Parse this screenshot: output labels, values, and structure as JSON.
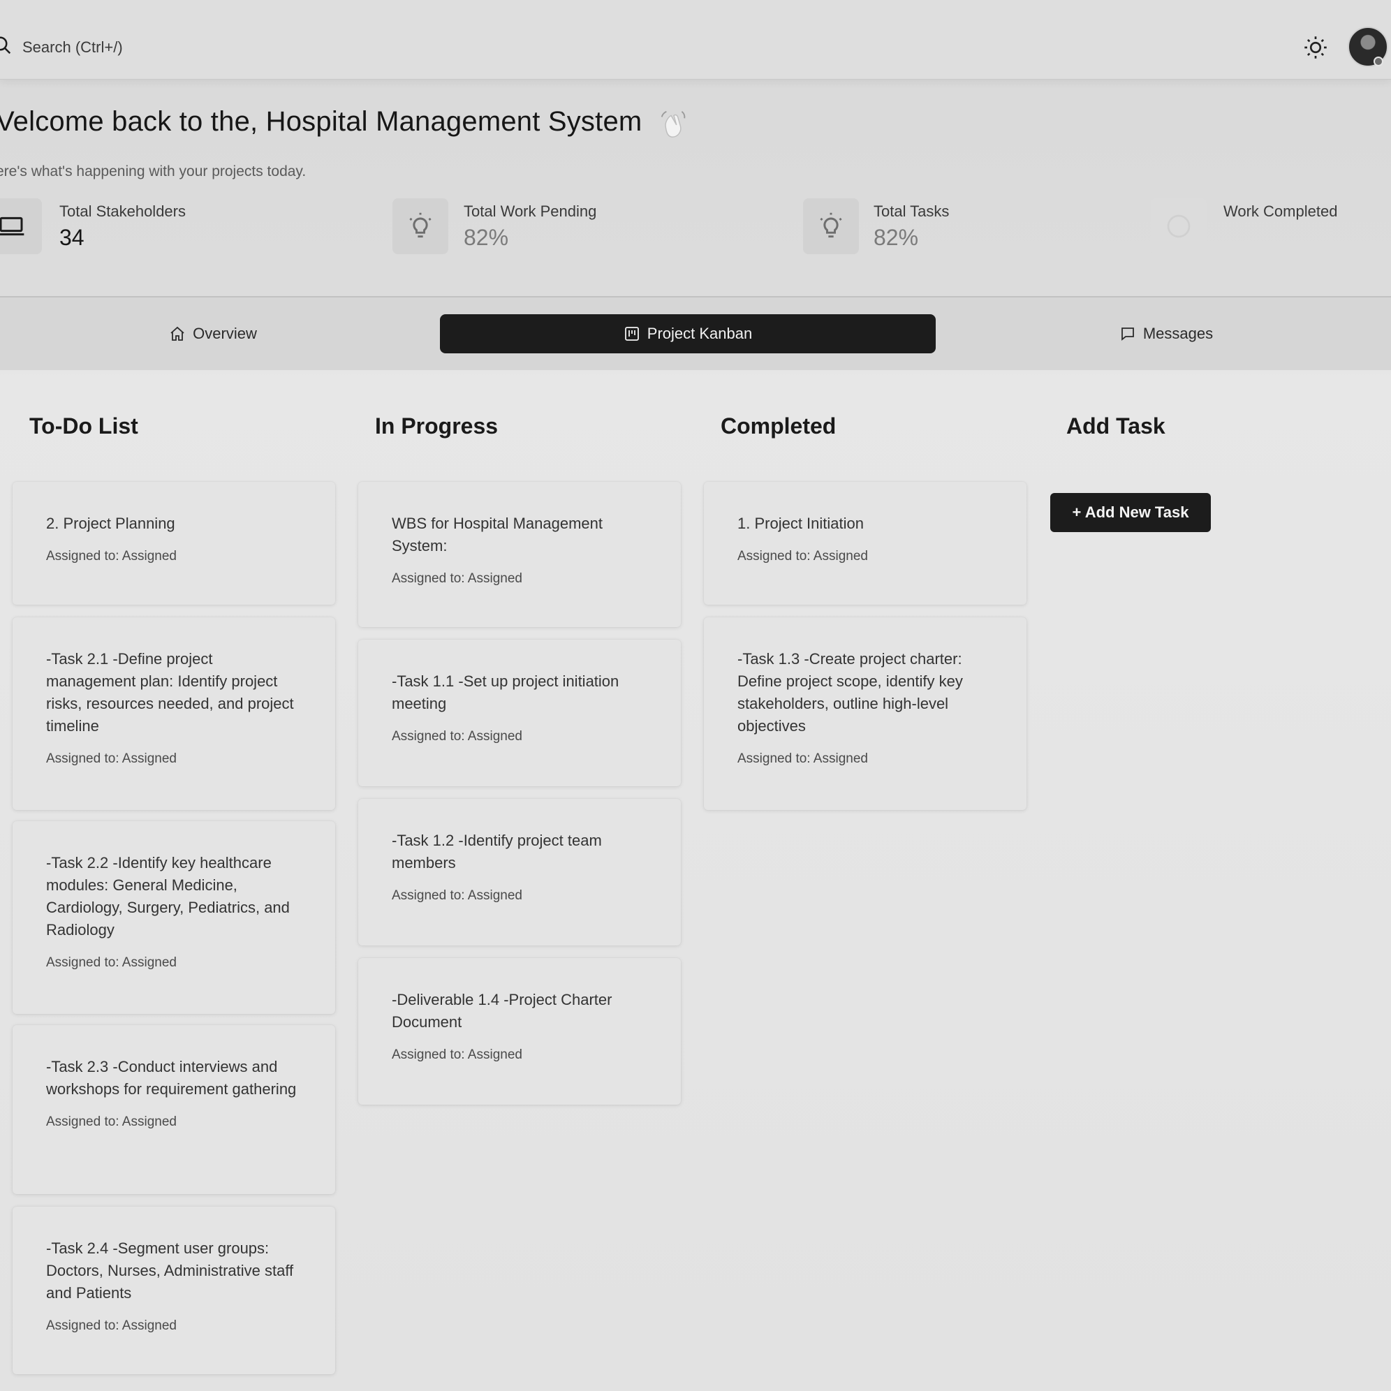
{
  "search": {
    "placeholder": "Search (Ctrl+/)"
  },
  "header": {
    "welcome": "Velcome back to the, Hospital Management System",
    "subtitle": "ere's what's happening with your projects today."
  },
  "stats": [
    {
      "label": "Total Stakeholders",
      "value": "34",
      "icon": "laptop-icon"
    },
    {
      "label": "Total Work Pending",
      "value": "82%",
      "icon": "lightbulb-icon"
    },
    {
      "label": "Total Tasks",
      "value": "82%",
      "icon": "lightbulb-icon"
    },
    {
      "label": "Work Completed",
      "value": "",
      "icon": "check-circle-icon"
    }
  ],
  "tabs": [
    {
      "label": "Overview",
      "icon": "home-icon"
    },
    {
      "label": "Project Kanban",
      "icon": "kanban-icon",
      "active": true
    },
    {
      "label": "Messages",
      "icon": "message-icon"
    }
  ],
  "kanban": {
    "columns": [
      {
        "title": "To-Do List",
        "cards": [
          {
            "title": "2. Project Planning",
            "assigned": "Assigned to: Assigned"
          },
          {
            "title": "-Task 2.1 -Define project management plan: Identify project risks, resources needed, and project timeline",
            "assigned": "Assigned to: Assigned"
          },
          {
            "title": "-Task 2.2 -Identify key healthcare modules: General Medicine, Cardiology, Surgery, Pediatrics, and Radiology",
            "assigned": "Assigned to: Assigned"
          },
          {
            "title": "-Task 2.3 -Conduct interviews and workshops for requirement gathering",
            "assigned": "Assigned to: Assigned"
          },
          {
            "title": "-Task 2.4 -Segment user groups: Doctors, Nurses, Administrative staff and Patients",
            "assigned": "Assigned to: Assigned"
          }
        ]
      },
      {
        "title": "In Progress",
        "cards": [
          {
            "title": "WBS for Hospital Management System:",
            "assigned": "Assigned to: Assigned"
          },
          {
            "title": "-Task 1.1 -Set up project initiation meeting",
            "assigned": "Assigned to: Assigned"
          },
          {
            "title": "-Task 1.2 -Identify project team members",
            "assigned": "Assigned to: Assigned"
          },
          {
            "title": "-Deliverable 1.4 -Project Charter Document",
            "assigned": "Assigned to: Assigned"
          }
        ]
      },
      {
        "title": "Completed",
        "cards": [
          {
            "title": "1. Project Initiation",
            "assigned": "Assigned to: Assigned"
          },
          {
            "title": "-Task 1.3 -Create project charter: Define project scope, identify key stakeholders, outline high-level objectives",
            "assigned": "Assigned to: Assigned"
          }
        ]
      },
      {
        "title": "Add Task",
        "button_label": "+ Add New Task"
      }
    ]
  }
}
